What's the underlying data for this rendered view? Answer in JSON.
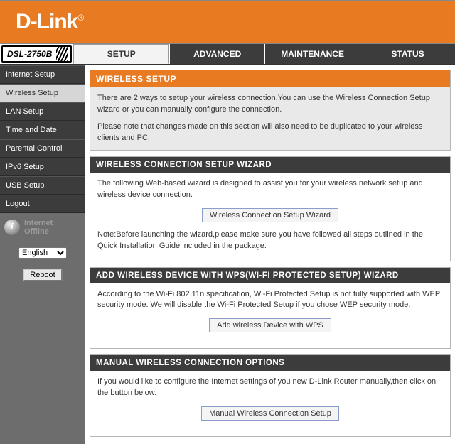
{
  "logo_text": "D-Link",
  "logo_reg": "®",
  "model": "DSL-2750B",
  "tabs": {
    "setup": "SETUP",
    "advanced": "ADVANCED",
    "maintenance": "MAINTENANCE",
    "status": "STATUS"
  },
  "sidebar": {
    "items": {
      "internet": "Internet Setup",
      "wireless": "Wireless Setup",
      "lan": "LAN Setup",
      "time": "Time and Date",
      "parental": "Parental Control",
      "ipv6": "IPv6 Setup",
      "usb": "USB Setup",
      "logout": "Logout"
    },
    "status_line1": "Internet",
    "status_line2": "Offline",
    "lang": "English",
    "reboot": "Reboot"
  },
  "intro": {
    "title": "WIRELESS SETUP",
    "p1": "There are 2 ways to setup your wireless connection.You can use the Wireless Connection Setup wizard or you can manually configure the connection.",
    "p2": "Please note that changes made on this section will also need to be duplicated to your wireless clients and PC."
  },
  "sec1": {
    "title": "WIRELESS CONNECTION SETUP WIZARD",
    "p1": "The following Web-based wizard is designed to assist you for your wireless network setup and wireless device connection.",
    "btn": "Wireless Connection Setup Wizard",
    "p2": "Note:Before launching the wizard,please make sure you have followed all steps outlined in the Quick Installation Guide included in the package."
  },
  "sec2": {
    "title": "ADD WIRELESS DEVICE WITH WPS(WI-FI PROTECTED SETUP) WIZARD",
    "p1": "According to the Wi-Fi 802.11n specification, Wi-Fi Protected Setup is not fully supported with WEP security mode. We will disable the Wi-Fi Protected Setup if you chose WEP security mode.",
    "btn": "Add wireless Device with WPS"
  },
  "sec3": {
    "title": "MANUAL WIRELESS CONNECTION OPTIONS",
    "p1": "If you would like to configure the Internet settings of you new D-Link Router manually,then click on the button below.",
    "btn": "Manual Wireless Connection Setup"
  }
}
